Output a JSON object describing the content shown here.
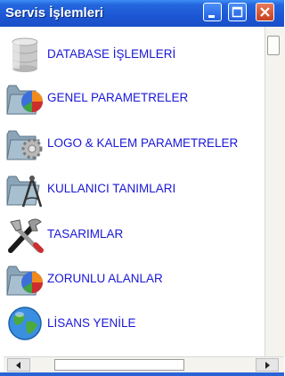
{
  "window": {
    "title": "Servis İşlemleri"
  },
  "menu": {
    "items": [
      {
        "label": "DATABASE İŞLEMLERİ",
        "icon": "database-icon"
      },
      {
        "label": "GENEL PARAMETRELER",
        "icon": "folder-chart-icon"
      },
      {
        "label": "LOGO & KALEM PARAMETRELER",
        "icon": "folder-gear-icon"
      },
      {
        "label": "KULLANICI TANIMLARI",
        "icon": "folder-compass-icon"
      },
      {
        "label": "TASARIMLAR",
        "icon": "tools-icon"
      },
      {
        "label": "ZORUNLU ALANLAR",
        "icon": "folder-chart-icon"
      },
      {
        "label": "LİSANS YENİLE",
        "icon": "globe-icon"
      }
    ]
  },
  "colors": {
    "titlebar": "#1c56d4",
    "link_text": "#1a17d6",
    "close_button": "#c5401f"
  }
}
